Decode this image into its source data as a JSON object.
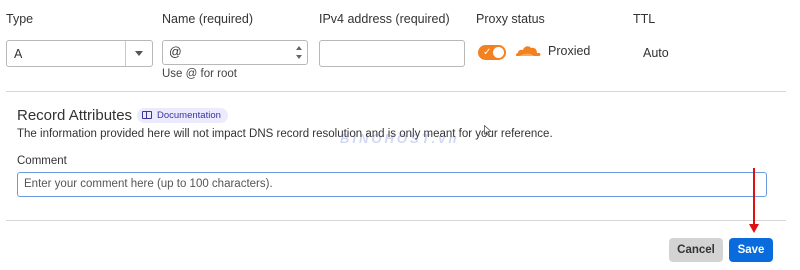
{
  "columns": {
    "type": "Type",
    "name": "Name (required)",
    "ipv4": "IPv4 address (required)",
    "proxy_status": "Proxy status",
    "ttl": "TTL"
  },
  "record": {
    "type_value": "A",
    "name_value": "@",
    "name_hint": "Use @ for root",
    "ipv4_value": "",
    "proxy_enabled": true,
    "proxy_label": "Proxied",
    "ttl_value": "Auto"
  },
  "attributes": {
    "title": "Record Attributes",
    "doc_link": "Documentation",
    "info": "The information provided here will not impact DNS record resolution and is only meant for your reference.",
    "comment_label": "Comment",
    "comment_placeholder": "Enter your comment here (up to 100 characters).",
    "comment_value": ""
  },
  "actions": {
    "cancel": "Cancel",
    "save": "Save"
  },
  "watermark": "BINOHOST.vn",
  "colors": {
    "accent_orange": "#f48120",
    "primary_blue": "#0a6bdc",
    "annotation_red": "#e01010",
    "badge_bg": "#eceaff"
  },
  "icons": [
    "chevron-down-icon",
    "spinner-up-icon",
    "spinner-down-icon",
    "check-icon",
    "cloud-icon",
    "book-icon",
    "red-arrow-annotation",
    "mouse-cursor-icon"
  ]
}
